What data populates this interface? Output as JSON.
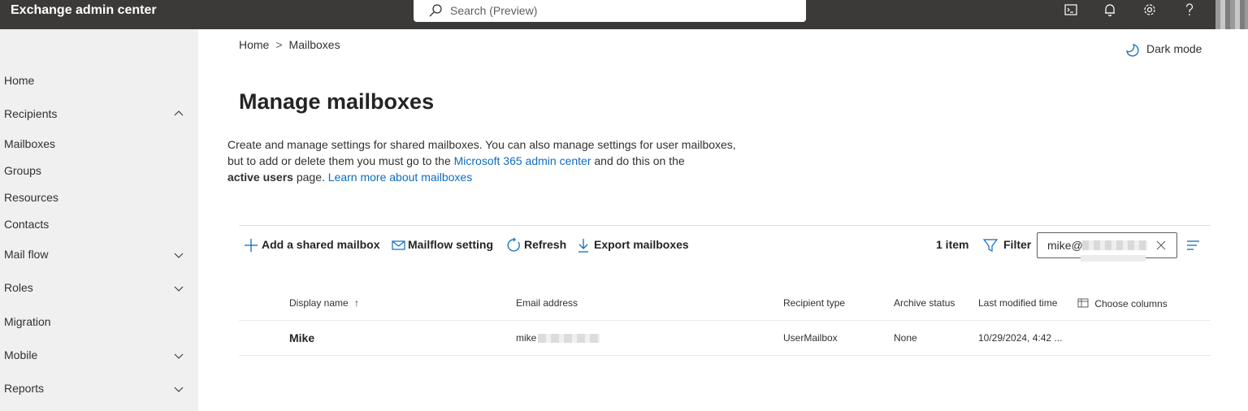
{
  "app": {
    "title": "Exchange admin center"
  },
  "search": {
    "placeholder": "Search (Preview)"
  },
  "topbar_icons": [
    "terminal-icon",
    "bell-icon",
    "gear-icon",
    "help-icon"
  ],
  "sidebar": {
    "items": [
      {
        "label": "Home",
        "expandable": false
      },
      {
        "label": "Recipients",
        "expandable": true,
        "expanded": true
      },
      {
        "label": "Mailboxes",
        "expandable": false
      },
      {
        "label": "Groups",
        "expandable": false
      },
      {
        "label": "Resources",
        "expandable": false
      },
      {
        "label": "Contacts",
        "expandable": false
      },
      {
        "label": "Mail flow",
        "expandable": true,
        "expanded": false
      },
      {
        "label": "Roles",
        "expandable": true,
        "expanded": false
      },
      {
        "label": "Migration",
        "expandable": false
      },
      {
        "label": "Mobile",
        "expandable": true,
        "expanded": false
      },
      {
        "label": "Reports",
        "expandable": true,
        "expanded": false
      }
    ]
  },
  "breadcrumb": {
    "home": "Home",
    "separator": ">",
    "current": "Mailboxes"
  },
  "dark_mode": {
    "label": "Dark mode"
  },
  "page": {
    "title": "Manage mailboxes",
    "desc_part1": "Create and manage settings for shared mailboxes. You can also manage settings for user mailboxes,",
    "desc_part2": "but to add or delete them you must go to the ",
    "desc_link1": "Microsoft 365 admin center",
    "desc_part3": " and do this on the",
    "desc_bold": "active users",
    "desc_part4": " page. ",
    "desc_link2": "Learn more about mailboxes"
  },
  "toolbar": {
    "add": "Add a shared mailbox",
    "mailflow": "Mailflow setting",
    "refresh": "Refresh",
    "export": "Export mailboxes",
    "item_count": "1 item",
    "filter": "Filter",
    "filter_value": "mike@"
  },
  "table": {
    "columns": {
      "display_name": "Display name",
      "sort_indicator": "↑",
      "email": "Email address",
      "recipient_type": "Recipient type",
      "archive_status": "Archive status",
      "last_modified": "Last modified time",
      "choose_columns": "Choose columns"
    },
    "rows": [
      {
        "display_name": "Mike",
        "email": "mike",
        "recipient_type": "UserMailbox",
        "archive_status": "None",
        "last_modified": "10/29/2024, 4:42 ..."
      }
    ]
  },
  "colors": {
    "topbar": "#3b3a39",
    "accent": "#0f6cbd",
    "sidebar": "#f0f0f0"
  }
}
